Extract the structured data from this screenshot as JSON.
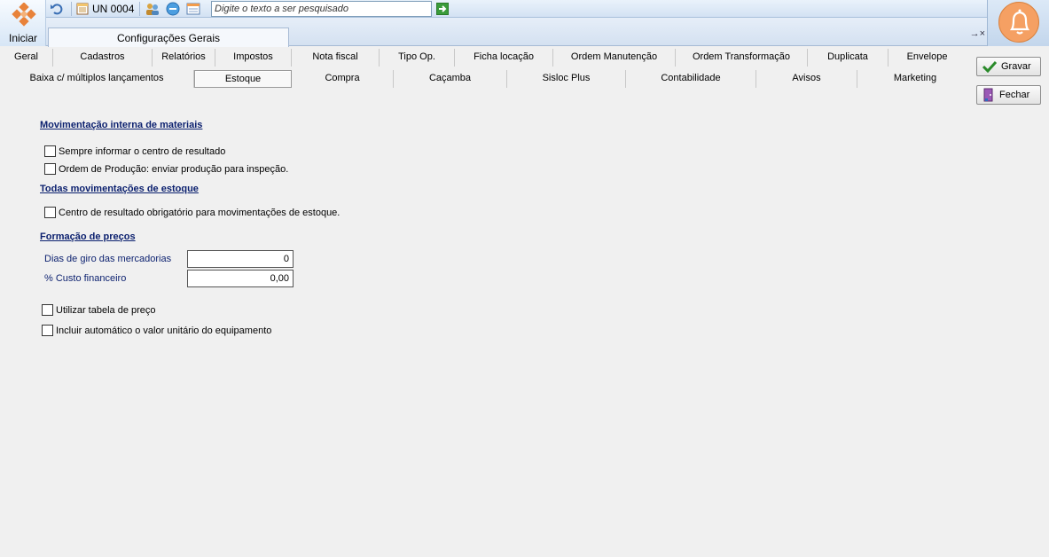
{
  "toolbar": {
    "start_label": "Iniciar",
    "unit_label": "UN 0004",
    "search_placeholder": "Digite o texto a ser pesquisado"
  },
  "window_tab": {
    "title": "Configurações Gerais",
    "controls": "→×"
  },
  "tabs_row1": [
    "Geral",
    "Cadastros",
    "Relatórios",
    "Impostos",
    "Nota fiscal",
    "Tipo Op.",
    "Ficha locação",
    "Ordem Manutenção",
    "Ordem Transformação",
    "Duplicata",
    "Envelope"
  ],
  "tabs_row2": [
    "Baixa c/ múltiplos lançamentos",
    "Estoque",
    "Compra",
    "Caçamba",
    "Sisloc Plus",
    "Contabilidade",
    "Avisos",
    "Marketing"
  ],
  "active_tab": "Estoque",
  "buttons": {
    "save": "Gravar",
    "close": "Fechar"
  },
  "sections": {
    "internal_movement": {
      "title": "Movimentação interna de materiais",
      "options": [
        {
          "label": "Sempre informar o centro de resultado",
          "checked": false
        },
        {
          "label": "Ordem de Produção: enviar produção para inspeção.",
          "checked": false
        }
      ]
    },
    "all_movements": {
      "title": "Todas movimentações de estoque",
      "options": [
        {
          "label": "Centro de resultado obrigatório para movimentações de estoque.",
          "checked": false
        }
      ]
    },
    "pricing": {
      "title": "Formação de preços",
      "fields": [
        {
          "label": "Dias de giro das mercadorias",
          "value": "0"
        },
        {
          "label": "% Custo financeiro",
          "value": "0,00"
        }
      ],
      "options": [
        {
          "label": "Utilizar tabela de preço",
          "checked": false
        },
        {
          "label": "Incluir automático o valor unitário do equipamento",
          "checked": false
        }
      ]
    }
  },
  "colors": {
    "section_title": "#0a1f6e",
    "accent_bell": "#f5a063",
    "toolbar_bg": "#d3e2f3"
  },
  "icons": [
    "start-logo-icon",
    "undo-icon",
    "calendar-icon",
    "users-icon",
    "refresh-icon",
    "window-icon",
    "go-arrow-icon",
    "bell-icon",
    "checkmark-icon",
    "door-exit-icon"
  ]
}
